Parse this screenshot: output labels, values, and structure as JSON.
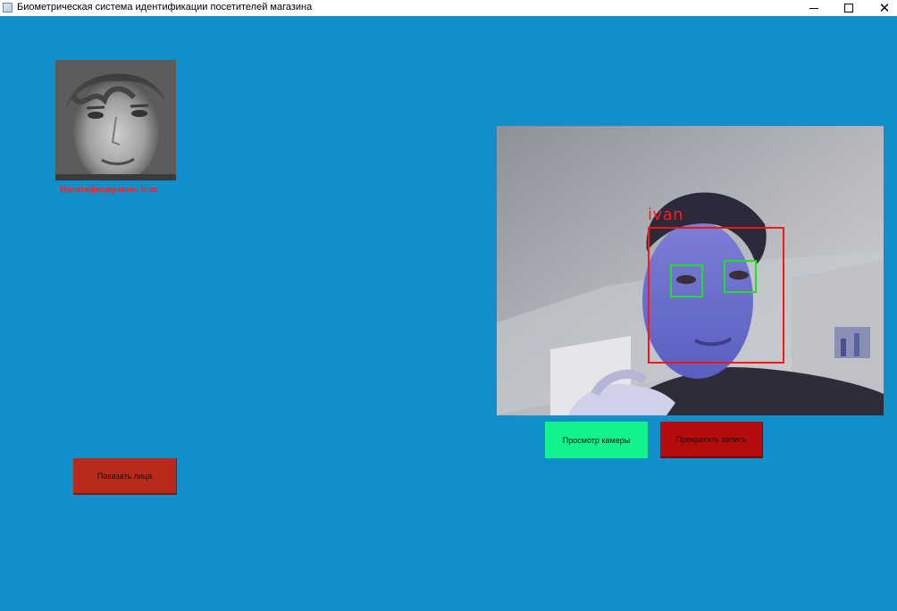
{
  "window": {
    "title": "Биометрическая система идентификации посетителей магазина",
    "icons": {
      "app": "app-window-icon",
      "minimize": "minimize-icon",
      "maximize": "maximize-icon",
      "close": "close-icon",
      "close_glyph": "✕"
    }
  },
  "identified": {
    "label": "Идентифицирован: Ivan"
  },
  "camera": {
    "person_label": "ivan"
  },
  "buttons": {
    "view_camera": "Просмотр камеры",
    "stop_recording": "Прекратить запись",
    "show_faces": "Показать лица"
  },
  "colors": {
    "background": "#108fca",
    "view_camera_button": "#12f38e",
    "stop_button": "#b50d0d",
    "show_faces_button": "#b72a1c",
    "face_box": "#ff1414",
    "eye_box": "#22e028",
    "label_red": "#ff2020"
  }
}
